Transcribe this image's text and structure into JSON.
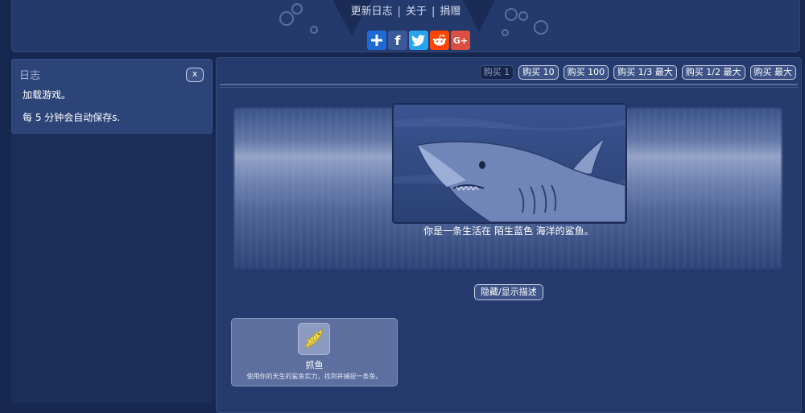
{
  "header": {
    "nav": [
      {
        "label": "更新日志"
      },
      {
        "label": "关于"
      },
      {
        "label": "捐赠"
      }
    ],
    "nav_separator": "|",
    "social": [
      {
        "name": "share",
        "icon": "plus-icon",
        "color": "#1f6bd6"
      },
      {
        "name": "facebook",
        "icon": "facebook-icon",
        "color": "#3b5998",
        "glyph": "f"
      },
      {
        "name": "twitter",
        "icon": "twitter-icon",
        "color": "#2aa3ef"
      },
      {
        "name": "reddit",
        "icon": "reddit-icon",
        "color": "#ff4500"
      },
      {
        "name": "google-plus",
        "icon": "google-plus-icon",
        "color": "#dc4e41",
        "glyph": "G+"
      }
    ]
  },
  "log": {
    "title": "日志",
    "close_label": "x",
    "messages": [
      "加载游戏。",
      "每 5 分钟会自动保存s."
    ]
  },
  "buy_buttons": [
    {
      "label": "购买 1",
      "active": true
    },
    {
      "label": "购买 10"
    },
    {
      "label": "购买 100"
    },
    {
      "label": "购买 1/3 最大"
    },
    {
      "label": "购买 1/2 最大"
    },
    {
      "label": "购买 最大"
    }
  ],
  "description": "你是一条生活在 陌生蓝色 海洋的鲨鱼。",
  "toggle_label": "隐藏/显示描述",
  "action_card": {
    "name": "抓鱼",
    "description": "使用你的天生的鲨鱼实力，找到并捕捉一条鱼。",
    "icon": "fish-icon",
    "icon_color": "#e9d34a"
  }
}
